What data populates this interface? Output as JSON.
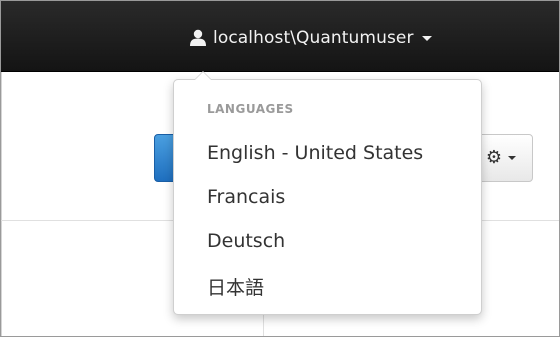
{
  "navbar": {
    "user_label": "localhost\\Quantumuser",
    "user_icon": "user-icon"
  },
  "content": {
    "settings_icon": "gear-icon"
  },
  "language_menu": {
    "header": "LANGUAGES",
    "items": [
      {
        "label": "English - United States"
      },
      {
        "label": "Francais"
      },
      {
        "label": "Deutsch"
      },
      {
        "label": "日本語"
      }
    ]
  },
  "colors": {
    "navbar_bg": "#1a1a1a",
    "primary_button": "#2a7dcf",
    "header_text": "#9a9a9a"
  }
}
